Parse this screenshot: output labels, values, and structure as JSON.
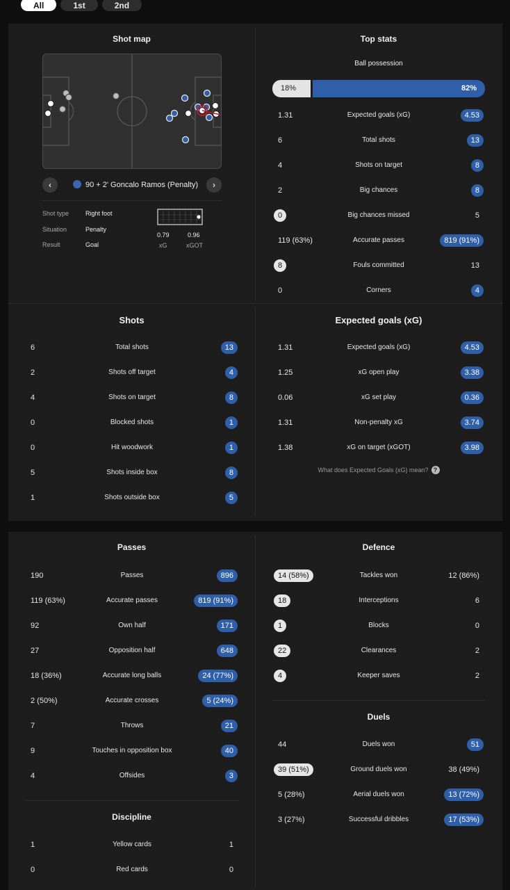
{
  "tabs": [
    "All",
    "1st",
    "2nd"
  ],
  "shot_map": {
    "title": "Shot map",
    "caption": "90 + 2' Goncalo Ramos (Penalty)",
    "prev_icon": "chevron-left-icon",
    "next_icon": "chevron-right-icon",
    "details": {
      "shot_type_label": "Shot type",
      "shot_type": "Right foot",
      "situation_label": "Situation",
      "situation": "Penalty",
      "result_label": "Result",
      "result": "Goal",
      "xg": "0.79",
      "xg_label": "xG",
      "xgot": "0.96",
      "xgot_label": "xGOT"
    }
  },
  "top_stats": {
    "title": "Top stats",
    "possession_label": "Ball possession",
    "possession_home": "18%",
    "possession_away": "82%",
    "possession_home_fraction": 0.18,
    "rows": [
      {
        "label": "Expected goals (xG)",
        "home": "1.31",
        "away": "4.53"
      },
      {
        "label": "Total shots",
        "home": "6",
        "away": "13"
      },
      {
        "label": "Shots on target",
        "home": "4",
        "away": "8"
      },
      {
        "label": "Big chances",
        "home": "2",
        "away": "8"
      },
      {
        "label": "Big chances missed",
        "home": "0",
        "away": "5"
      },
      {
        "label": "Accurate passes",
        "home": "119 (63%)",
        "away": "819 (91%)"
      },
      {
        "label": "Fouls committed",
        "home": "8",
        "away": "13"
      },
      {
        "label": "Corners",
        "home": "0",
        "away": "4"
      }
    ]
  },
  "shots": {
    "title": "Shots",
    "rows": [
      {
        "label": "Total shots",
        "home": "6",
        "away": "13"
      },
      {
        "label": "Shots off target",
        "home": "2",
        "away": "4"
      },
      {
        "label": "Shots on target",
        "home": "4",
        "away": "8"
      },
      {
        "label": "Blocked shots",
        "home": "0",
        "away": "1"
      },
      {
        "label": "Hit woodwork",
        "home": "0",
        "away": "1"
      },
      {
        "label": "Shots inside box",
        "home": "5",
        "away": "8"
      },
      {
        "label": "Shots outside box",
        "home": "1",
        "away": "5"
      }
    ]
  },
  "xg": {
    "title": "Expected goals (xG)",
    "rows": [
      {
        "label": "Expected goals (xG)",
        "home": "1.31",
        "away": "4.53"
      },
      {
        "label": "xG open play",
        "home": "1.25",
        "away": "3.38"
      },
      {
        "label": "xG set play",
        "home": "0.06",
        "away": "0.36"
      },
      {
        "label": "Non-penalty xG",
        "home": "1.31",
        "away": "3.74"
      },
      {
        "label": "xG on target (xGOT)",
        "home": "1.38",
        "away": "3.98"
      }
    ],
    "help_text": "What does Expected Goals (xG) mean?",
    "help_icon": "question-icon"
  },
  "passes": {
    "title": "Passes",
    "rows": [
      {
        "label": "Passes",
        "home": "190",
        "away": "896"
      },
      {
        "label": "Accurate passes",
        "home": "119 (63%)",
        "away": "819 (91%)"
      },
      {
        "label": "Own half",
        "home": "92",
        "away": "171"
      },
      {
        "label": "Opposition half",
        "home": "27",
        "away": "648"
      },
      {
        "label": "Accurate long balls",
        "home": "18 (36%)",
        "away": "24 (77%)"
      },
      {
        "label": "Accurate crosses",
        "home": "2 (50%)",
        "away": "5 (24%)"
      },
      {
        "label": "Throws",
        "home": "7",
        "away": "21"
      },
      {
        "label": "Touches in opposition box",
        "home": "9",
        "away": "40"
      },
      {
        "label": "Offsides",
        "home": "4",
        "away": "3"
      }
    ]
  },
  "discipline": {
    "title": "Discipline",
    "rows": [
      {
        "label": "Yellow cards",
        "home": "1",
        "away": "1"
      },
      {
        "label": "Red cards",
        "home": "0",
        "away": "0"
      }
    ]
  },
  "defence": {
    "title": "Defence",
    "rows": [
      {
        "label": "Tackles won",
        "home": "14 (58%)",
        "away": "12 (86%)"
      },
      {
        "label": "Interceptions",
        "home": "18",
        "away": "6"
      },
      {
        "label": "Blocks",
        "home": "1",
        "away": "0"
      },
      {
        "label": "Clearances",
        "home": "22",
        "away": "2"
      },
      {
        "label": "Keeper saves",
        "home": "4",
        "away": "2"
      }
    ]
  },
  "duels": {
    "title": "Duels",
    "rows": [
      {
        "label": "Duels won",
        "home": "44",
        "away": "51"
      },
      {
        "label": "Ground duels won",
        "home": "39 (51%)",
        "away": "38 (49%)"
      },
      {
        "label": "Aerial duels won",
        "home": "5 (28%)",
        "away": "13 (72%)"
      },
      {
        "label": "Successful dribbles",
        "home": "3 (27%)",
        "away": "17 (53%)"
      }
    ]
  },
  "colors": {
    "home_pill": "#e6e6e6",
    "away_pill": "#2f5fa8",
    "panel": "#1d1d1d",
    "background": "#0f0f0f"
  }
}
